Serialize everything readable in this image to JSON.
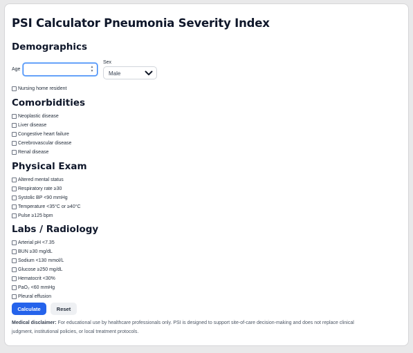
{
  "title": "PSI Calculator Pneumonia Severity Index",
  "sections": {
    "demographics": "Demographics",
    "comorbidities": "Comorbidities",
    "physical_exam": "Physical Exam",
    "labs": "Labs / Radiology"
  },
  "demographics": {
    "age_label": "Age",
    "age_value": "",
    "sex_label": "Sex",
    "sex_value": "Male",
    "nursing_home": "Nursing home resident"
  },
  "comorbidities": [
    "Neoplastic disease",
    "Liver disease",
    "Congestive heart failure",
    "Cerebrovascular disease",
    "Renal disease"
  ],
  "physical_exam": [
    "Altered mental status",
    "Respiratory rate ≥30",
    "Systolic BP <90 mmHg",
    "Temperature <35°C or ≥40°C",
    "Pulse ≥125 bpm"
  ],
  "labs": [
    "Arterial pH <7.35",
    "BUN ≥30 mg/dL",
    "Sodium <130 mmol/L",
    "Glucose ≥250 mg/dL",
    "Hematocrit <30%",
    "PaO₂ <60 mmHg",
    "Pleural effusion"
  ],
  "buttons": {
    "calculate": "Calculate",
    "reset": "Reset"
  },
  "disclaimer": {
    "label": "Medical disclaimer:",
    "text": " For educational use by healthcare professionals only. PSI is designed to support site-of-care decision-making and does not replace clinical judgment, institutional policies, or local treatment protocols."
  },
  "colors": {
    "primary": "#2563eb",
    "focus": "#3b82f6"
  },
  "icons": {
    "sex_dropdown": "chevron-down-icon",
    "age_spinner": "spinner-arrows-icon"
  }
}
